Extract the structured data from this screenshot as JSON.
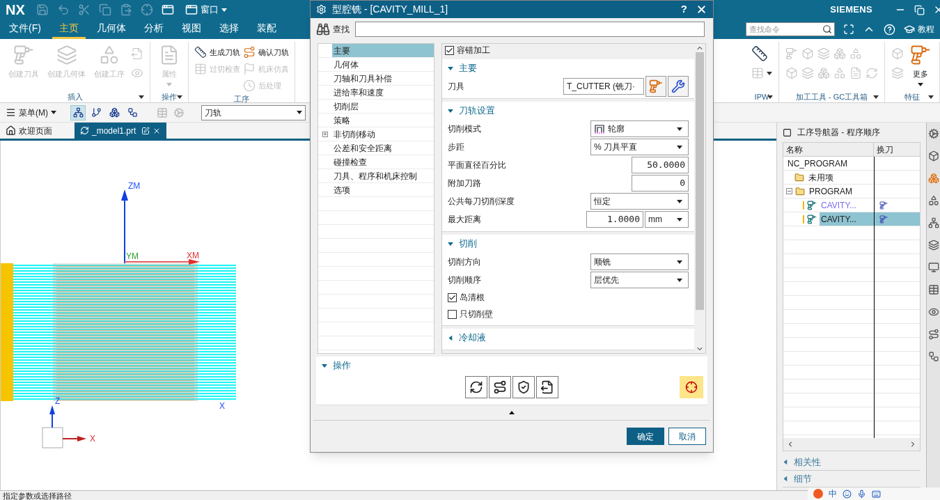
{
  "title_bar": {
    "logo": "NX",
    "window_menu": "窗口",
    "brand": "SIEMENS"
  },
  "menu_tabs": [
    {
      "label": "文件(F)",
      "selected": false
    },
    {
      "label": "主页",
      "selected": true
    },
    {
      "label": "几何体",
      "selected": false
    },
    {
      "label": "分析",
      "selected": false
    },
    {
      "label": "视图",
      "selected": false
    },
    {
      "label": "选择",
      "selected": false
    },
    {
      "label": "装配",
      "selected": false
    }
  ],
  "command_search": {
    "placeholder": "查找命令"
  },
  "help_link": "教程",
  "ribbon": {
    "left_groups": [
      {
        "label": "插入",
        "menu": true,
        "items": [
          {
            "kind": "large",
            "label": "创建刀具",
            "disabled": true
          },
          {
            "kind": "large",
            "label": "创建几何体",
            "disabled": true
          },
          {
            "kind": "large",
            "label": "创建工序",
            "disabled": true
          },
          {
            "kind": "stack",
            "items": [
              {
                "kind": "icon",
                "disabled": true
              },
              {
                "kind": "icon",
                "disabled": true
              }
            ]
          }
        ]
      },
      {
        "label": "操作",
        "menu": true,
        "items": [
          {
            "kind": "large",
            "label": "属性",
            "disabled": true,
            "dropdown": true
          }
        ]
      },
      {
        "label": "工序",
        "menu": false,
        "items": [
          {
            "kind": "stack",
            "items": [
              {
                "kind": "small",
                "label": "生成刀轨",
                "disabled": false
              },
              {
                "kind": "small",
                "label": "过切检查",
                "disabled": true
              }
            ]
          },
          {
            "kind": "stack",
            "items": [
              {
                "kind": "small",
                "label": "确认刀轨",
                "disabled": false
              },
              {
                "kind": "small",
                "label": "机床仿真",
                "disabled": true
              },
              {
                "kind": "small",
                "label": "后处理",
                "disabled": true
              }
            ]
          }
        ]
      }
    ],
    "right_groups": [
      {
        "label": "IPW",
        "menu": true,
        "items": [
          {
            "kind": "stack",
            "items": [
              {
                "kind": "icon",
                "disabled": false
              },
              {
                "kind": "icon",
                "disabled": true,
                "dropdown": true
              }
            ]
          }
        ]
      },
      {
        "label": "加工工具 - GC工具箱",
        "menu": true,
        "items": [
          {
            "kind": "stack",
            "items": [
              {
                "kind": "row",
                "items": [
                  {
                    "kind": "icon",
                    "disabled": true
                  },
                  {
                    "kind": "icon",
                    "disabled": true
                  },
                  {
                    "kind": "icon",
                    "disabled": true
                  },
                  {
                    "kind": "icon",
                    "disabled": true
                  },
                  {
                    "kind": "icon",
                    "disabled": true
                  }
                ]
              },
              {
                "kind": "row",
                "items": [
                  {
                    "kind": "icon",
                    "disabled": true
                  },
                  {
                    "kind": "icon",
                    "disabled": true
                  },
                  {
                    "kind": "icon",
                    "disabled": true
                  },
                  {
                    "kind": "icon",
                    "disabled": true
                  },
                  {
                    "kind": "icon",
                    "disabled": true
                  },
                  {
                    "kind": "icon",
                    "disabled": true
                  }
                ]
              }
            ]
          }
        ]
      },
      {
        "label": "特征",
        "menu": true,
        "items": [
          {
            "kind": "stack",
            "items": [
              {
                "kind": "icon",
                "disabled": true
              },
              {
                "kind": "icon",
                "disabled": true
              }
            ]
          },
          {
            "kind": "large",
            "label": "更多",
            "disabled": false,
            "dropdown": true
          }
        ]
      }
    ]
  },
  "toolbar": {
    "menu": "菜单(M)",
    "view_buttons": [
      {
        "selected": true
      },
      {
        "selected": false
      },
      {
        "selected": false
      },
      {
        "selected": false
      }
    ],
    "filter": "刀轨"
  },
  "doc_tabs": [
    {
      "label": "欢迎页面",
      "selected": false
    },
    {
      "label": "_model1.prt",
      "selected": true
    }
  ],
  "graphics": {
    "axis_labels": [
      "ZM",
      "YM",
      "XM",
      "Z",
      "X",
      "X"
    ]
  },
  "navigator": {
    "title": "工序导航器 - 程序顺序",
    "columns": [
      "名称",
      "换刀"
    ],
    "tree": [
      {
        "name": "NC_PROGRAM",
        "selected": false,
        "children": [
          {
            "name": "未用项",
            "selected": false
          },
          {
            "name": "PROGRAM",
            "selected": false,
            "expanded": true,
            "children": [
              {
                "name": "CAVITY...",
                "selected": false,
                "current": true
              },
              {
                "name": "CAVITY...",
                "selected": true,
                "current": false
              }
            ]
          }
        ]
      }
    ],
    "sections": [
      {
        "title": "相关性",
        "expanded": false
      },
      {
        "title": "细节",
        "expanded": false
      }
    ]
  },
  "status_bar": "指定参数或选择路径",
  "ime": "中",
  "dialog": {
    "title": "型腔铣 - [CAVITY_MILL_1]",
    "help": "?",
    "find_label": "查找",
    "nav": [
      {
        "label": "主要",
        "selected": true
      },
      {
        "label": "几何体",
        "selected": false
      },
      {
        "label": "刀轴和刀具补偿",
        "selected": false
      },
      {
        "label": "进给率和速度",
        "selected": false
      },
      {
        "label": "切削层",
        "selected": false
      },
      {
        "label": "策略",
        "selected": false
      },
      {
        "label": "非切削移动",
        "selected": false,
        "expanded": false
      },
      {
        "label": "公差和安全距离",
        "selected": false
      },
      {
        "label": "碰撞检查",
        "selected": false
      },
      {
        "label": "刀具、程序和机床控制",
        "selected": false
      },
      {
        "label": "选项",
        "selected": false
      }
    ],
    "fault_tolerant": {
      "label": "容错加工",
      "checked": true
    },
    "sections": [
      {
        "title": "主要",
        "expanded": true,
        "rows": [
          {
            "kind": "tool",
            "label": "刀具",
            "value": "T_CUTTER (铣刀·"
          }
        ]
      },
      {
        "title": "刀轨设置",
        "expanded": true,
        "rows": [
          {
            "kind": "icon_select",
            "label": "切削模式",
            "value": "轮廓"
          },
          {
            "kind": "select",
            "label": "步距",
            "value": "% 刀具平直"
          },
          {
            "kind": "number",
            "label": "平面直径百分比",
            "value": "50.0000"
          },
          {
            "kind": "number",
            "label": "附加刀路",
            "value": "0"
          },
          {
            "kind": "select",
            "label": "公共每刀切削深度",
            "value": "恒定"
          },
          {
            "kind": "number_unit",
            "label": "最大距离",
            "value": "1.0000",
            "unit": "mm"
          }
        ]
      },
      {
        "title": "切削",
        "expanded": true,
        "rows": [
          {
            "kind": "select",
            "label": "切削方向",
            "value": "顺铣"
          },
          {
            "kind": "select",
            "label": "切削顺序",
            "value": "层优先"
          },
          {
            "kind": "checkbox",
            "label": "岛清根",
            "checked": true
          },
          {
            "kind": "checkbox",
            "label": "只切削壁",
            "checked": false
          }
        ]
      },
      {
        "title": "冷却液",
        "expanded": false
      }
    ],
    "actions": {
      "title": "操作",
      "expanded": true,
      "display_toggle": true
    },
    "buttons": [
      {
        "label": "确定",
        "kind": "primary"
      },
      {
        "label": "取消",
        "kind": "secondary"
      }
    ]
  }
}
